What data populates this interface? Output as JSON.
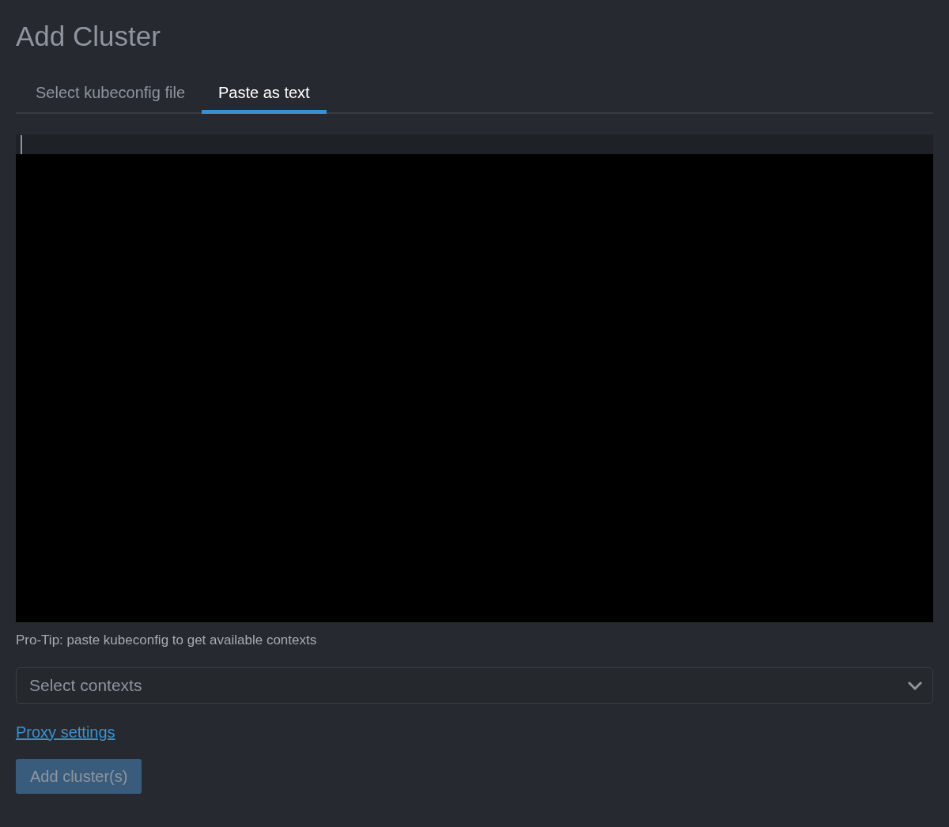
{
  "title": "Add Cluster",
  "tabs": [
    {
      "label": "Select kubeconfig file",
      "selected": false
    },
    {
      "label": "Paste as text",
      "selected": true
    }
  ],
  "tip": "Pro-Tip: paste kubeconfig to get available contexts",
  "context_select": {
    "placeholder": "Select contexts"
  },
  "proxy_link": "Proxy settings",
  "submit": {
    "label": "Add cluster(s)",
    "disabled": true
  }
}
